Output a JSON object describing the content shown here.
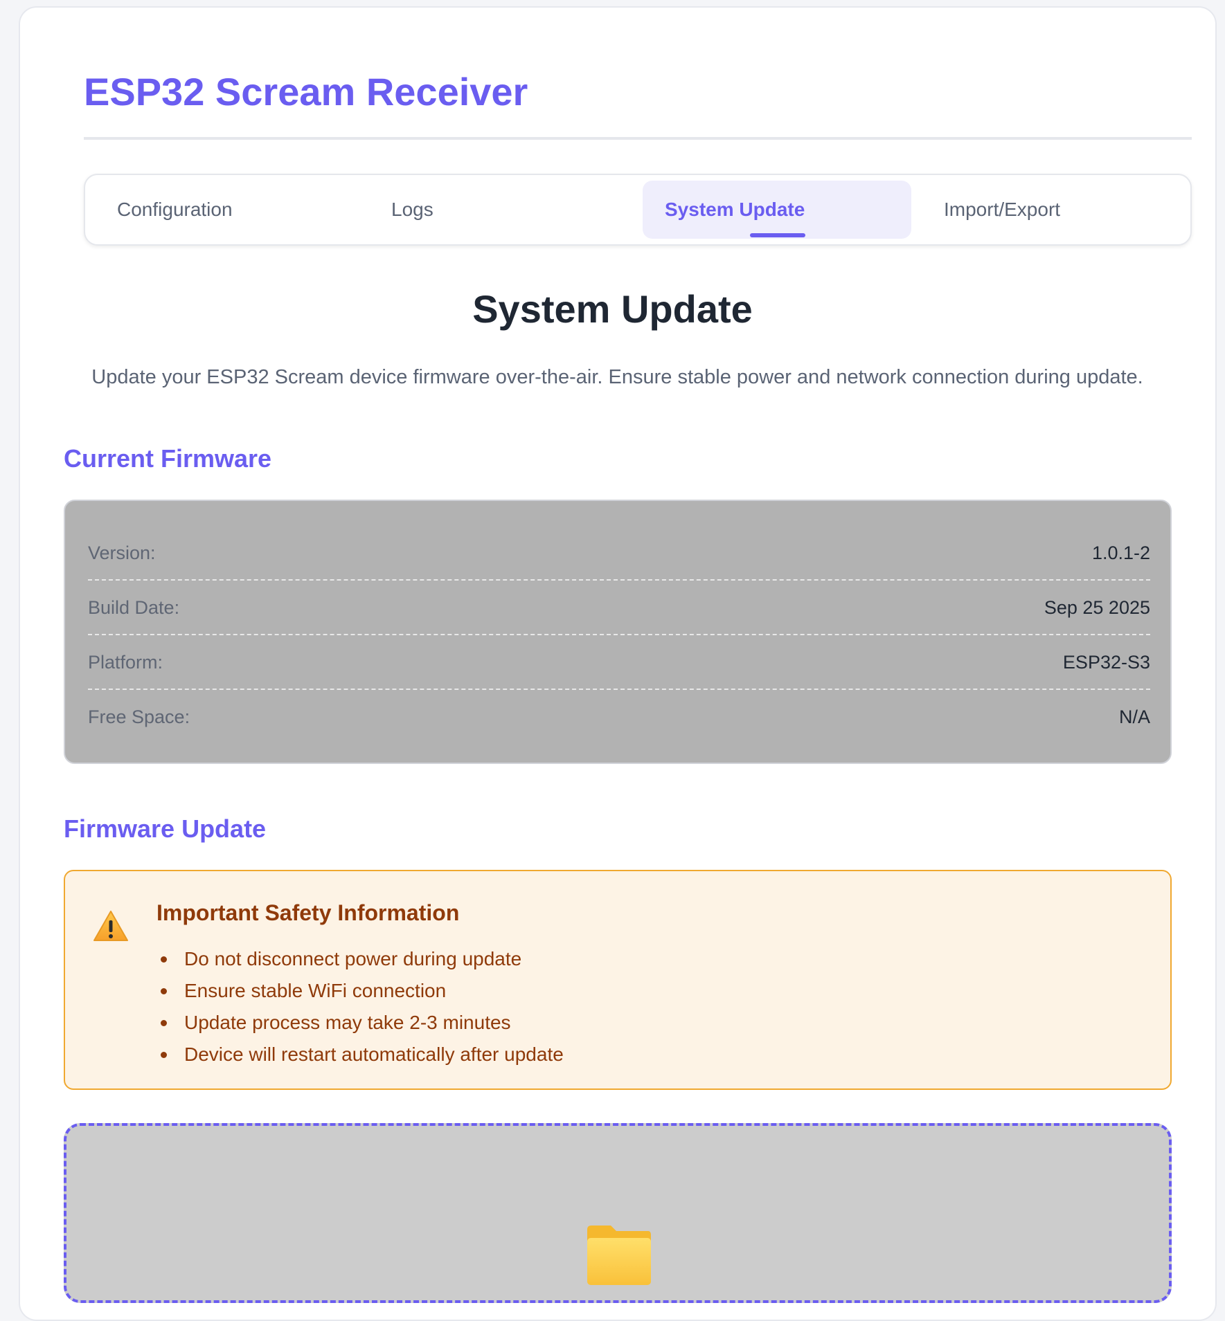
{
  "app": {
    "title": "ESP32 Scream Receiver"
  },
  "tabs": [
    {
      "label": "Configuration",
      "active": false
    },
    {
      "label": "Logs",
      "active": false
    },
    {
      "label": "System Update",
      "active": true
    },
    {
      "label": "Import/Export",
      "active": false
    }
  ],
  "page": {
    "heading": "System Update",
    "subtitle": "Update your ESP32 Scream device firmware over-the-air. Ensure stable power and network connection during update."
  },
  "current_firmware": {
    "heading": "Current Firmware",
    "rows": [
      {
        "key": "Version:",
        "value": "1.0.1-2"
      },
      {
        "key": "Build Date:",
        "value": "Sep 25 2025"
      },
      {
        "key": "Platform:",
        "value": "ESP32-S3"
      },
      {
        "key": "Free Space:",
        "value": "N/A"
      }
    ]
  },
  "firmware_update": {
    "heading": "Firmware Update",
    "warning": {
      "icon": "warning-icon",
      "title": "Important Safety Information",
      "items": [
        "Do not disconnect power during update",
        "Ensure stable WiFi connection",
        "Update process may take 2-3 minutes",
        "Device will restart automatically after update"
      ]
    },
    "dropzone": {
      "icon": "folder-icon"
    }
  },
  "colors": {
    "accent": "#6a5df0",
    "warning_text": "#8f3a0a",
    "warning_border": "#f0a830",
    "warning_bg": "#fdf3e5",
    "info_box_bg": "#b2b2b2",
    "dropzone_bg": "#cccccc"
  }
}
